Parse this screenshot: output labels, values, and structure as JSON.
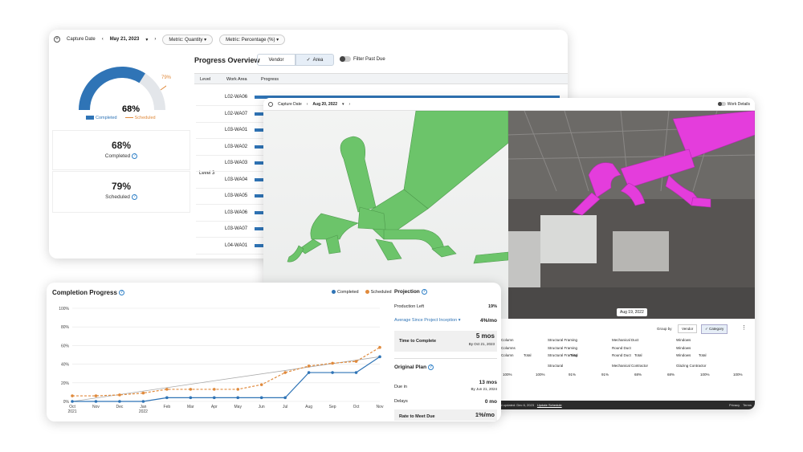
{
  "dashboard": {
    "capture_label": "Capture Date",
    "capture_date": "May 21, 2023",
    "metric1": "Metric: Quantity",
    "metric2": "Metric: Percentage (%)",
    "gauge_value": "68%",
    "gauge_scheduled": "79%",
    "gauge_completed_fraction": 0.68,
    "gauge_scheduled_fraction": 0.79,
    "legend_completed": "Completed",
    "legend_scheduled": "Scheduled",
    "completed_value": "68%",
    "completed_label": "Completed",
    "scheduled_value": "79%",
    "scheduled_label": "Scheduled",
    "overview_title": "Progress Overview",
    "toggle_vendor": "Vendor",
    "toggle_area": "Area",
    "filter_label": "Filter Past Due",
    "col_level": "Level",
    "col_work_area": "Work Area",
    "col_progress": "Progress",
    "level3": "Level 3",
    "work_areas": [
      "L02-WA06",
      "L02-WA07",
      "L03-WA01",
      "L03-WA02",
      "L03-WA03",
      "L03-WA04",
      "L03-WA05",
      "L03-WA06",
      "L03-WA07",
      "L04-WA01",
      "L04-WA02"
    ]
  },
  "viewer": {
    "capture_label": "Capture Date",
    "capture_date": "Aug 20, 2022",
    "work_details": "Work Details",
    "photo_date": "Aug 19, 2022",
    "group_by": "Group by",
    "group_vendor": "Vendor",
    "group_category": "Category",
    "columns": [
      "Column",
      "Structural Framing",
      "Mechanical Duct",
      "Windows"
    ],
    "subs": [
      "Columns",
      "Structural Framing",
      "Round Duct",
      "Windows"
    ],
    "subs2": [
      "Column",
      "Structural Framing",
      "Round Duct",
      "Windows"
    ],
    "total": "Total",
    "row_vals": [
      "100%",
      "100%",
      "91%",
      "91%",
      "68%",
      "68%",
      "100%",
      "100%"
    ],
    "contractors": [
      "Structural",
      "Mechanical Contractor",
      "Glazing Contractor"
    ],
    "footer_text": "Last updated: Dec 6, 2023",
    "footer_link": "Update Schedule",
    "privacy": "Privacy",
    "terms": "Terms"
  },
  "completion": {
    "title": "Completion Progress",
    "legend_completed": "Completed",
    "legend_scheduled": "Scheduled",
    "projection_title": "Projection",
    "production_left_label": "Production Left",
    "production_left_value": "19%",
    "average_label": "Average Since Project Inception",
    "average_value": "4%/mo",
    "time_label": "Time to Complete",
    "time_value": "5 mos",
    "time_date": "By Oct 21, 2023",
    "original_title": "Original Plan",
    "due_label": "Due in",
    "due_value": "13 mos",
    "due_date": "By Jun 21, 2024",
    "delays_label": "Delays",
    "delays_value": "0 mo",
    "rate_label": "Rate to Meet Due",
    "rate_value": "1%/mo"
  },
  "colors": {
    "completed": "#2f74b6",
    "scheduled": "#e08a3c",
    "green_model": "#6cc46a",
    "magenta": "#e43ddc"
  },
  "chart_data": {
    "type": "line",
    "x": [
      "Oct 2021",
      "Nov",
      "Dec",
      "Jan 2022",
      "Feb",
      "Mar",
      "Apr",
      "May",
      "Jun",
      "Jul",
      "Aug",
      "Sep",
      "Oct",
      "Nov"
    ],
    "x_ticks": [
      "Oct\n2021",
      "Nov",
      "Dec",
      "Jan\n2022",
      "Feb",
      "Mar",
      "Apr",
      "May",
      "Jun",
      "Jul",
      "Aug",
      "Sep",
      "Oct",
      "Nov"
    ],
    "ylim": [
      0,
      100
    ],
    "y_ticks": [
      "0%",
      "20%",
      "40%",
      "60%",
      "80%",
      "100%"
    ],
    "series": [
      {
        "name": "Completed",
        "values": [
          0,
          0,
          0,
          0,
          4,
          4,
          4,
          4,
          4,
          4,
          31,
          31,
          31,
          48
        ]
      },
      {
        "name": "Scheduled",
        "values": [
          6,
          6,
          7,
          9,
          13,
          13,
          13,
          13,
          18,
          31,
          38,
          41,
          43,
          58
        ]
      }
    ],
    "grid": true
  }
}
